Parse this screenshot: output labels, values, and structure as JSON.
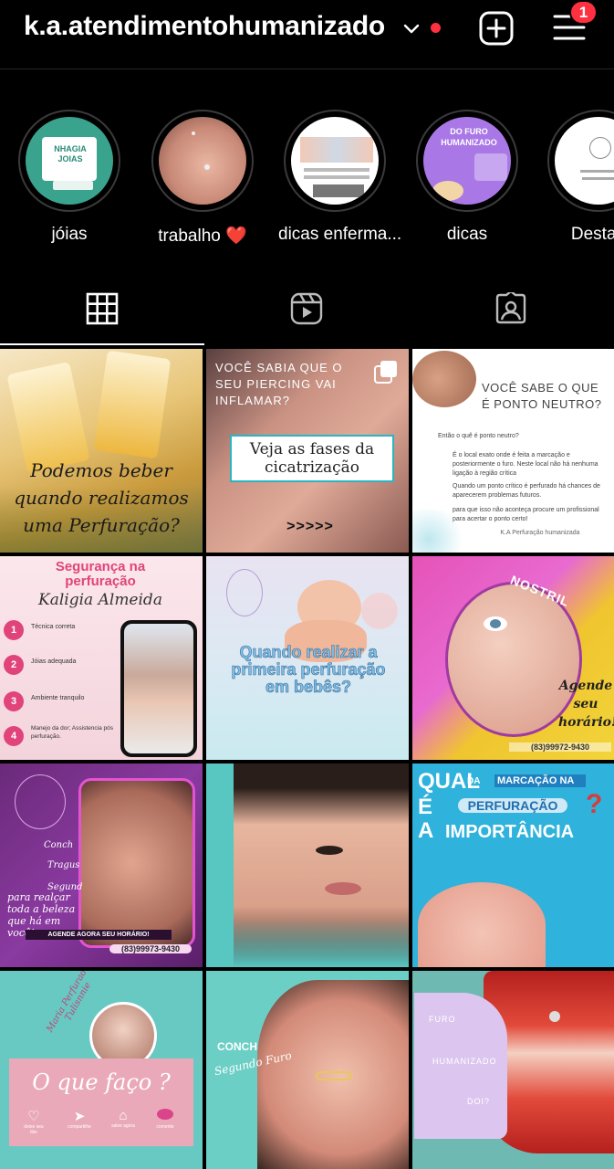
{
  "header": {
    "username": "k.a.atendimentohumanizado",
    "notification_count": "1",
    "live_dot_color": "#ff3040"
  },
  "highlights": [
    {
      "label": "jóias"
    },
    {
      "label": "trabalho ❤️"
    },
    {
      "label": "dicas enferma..."
    },
    {
      "label": "dicas"
    },
    {
      "label": "Destaq"
    }
  ],
  "highlight_inner": {
    "joias_text": "NHAGIA JOIAS",
    "dicas_text": "DO FURO HUMANIZADO"
  },
  "tabs": [
    {
      "icon": "grid-icon",
      "active": true
    },
    {
      "icon": "reels-icon",
      "active": false
    },
    {
      "icon": "tagged-icon",
      "active": false
    }
  ],
  "posts": {
    "p1": {
      "caption": "Podemos beber quando realizamos uma Perfuração?"
    },
    "p2": {
      "top": "VOCÊ SABIA QUE O SEU PIERCING VAI INFLAMAR?",
      "box": "Veja as fases da cicatrização",
      "arrows": ">>>>>"
    },
    "p3": {
      "title": "VOCÊ SABE O QUE É PONTO NEUTRO?",
      "q": "Então o quê é ponto neutro?",
      "p1": "É o local exato onde é feita a marcação e posteriormente o furo. Neste local não há nenhuma ligação à região crítica",
      "p2": "Quando um ponto crítico é perfurado há chances de aparecerem problemas futuros.",
      "p3": "para que isso não aconteça procure um profissional para acertar o ponto certo!",
      "sign": "K.A Perfuração humanizada"
    },
    "p4": {
      "title": "Segurança na perfuração",
      "name": "Kaligia Almeida",
      "items": [
        "Técnica correta",
        "Jóias adequada",
        "Ambiente tranquilo",
        "Manejo da dor; Assistencia pós perfuração."
      ]
    },
    "p5": {
      "caption": "Quando realizar a primeira perfuração em bebês?"
    },
    "p6": {
      "tag": "NOSTRIL",
      "cta": "Agende seu horário!",
      "phone": "(83)99972-9430"
    },
    "p7": {
      "labels": [
        "Conch",
        "Tragus",
        "Segund"
      ],
      "text": "para realçar toda a beleza que há em você!",
      "cta": "AGENDE AGORA SEU HORÁRIO!",
      "phone": "(83)99973-9430"
    },
    "p8": {},
    "p9": {
      "w1": "QUAL",
      "w2": "É",
      "w3": "A",
      "da": "DA",
      "marc": "MARCAÇÃO NA",
      "perf": "PERFURAÇÃO",
      "imp": "IMPORTÂNCIA"
    },
    "p10": {
      "name": "Maria Perfurador Tulisnnie",
      "caption": "O que faço ?",
      "actions": [
        "deixe seu like",
        "compartilhe",
        "salve agora",
        "comente"
      ]
    },
    "p11": {
      "label1": "CONCH",
      "label2": "Segundo Furo"
    },
    "p12": {
      "l1": "FURO",
      "l2": "HUMANIZADO",
      "l3": "DOI?"
    }
  }
}
